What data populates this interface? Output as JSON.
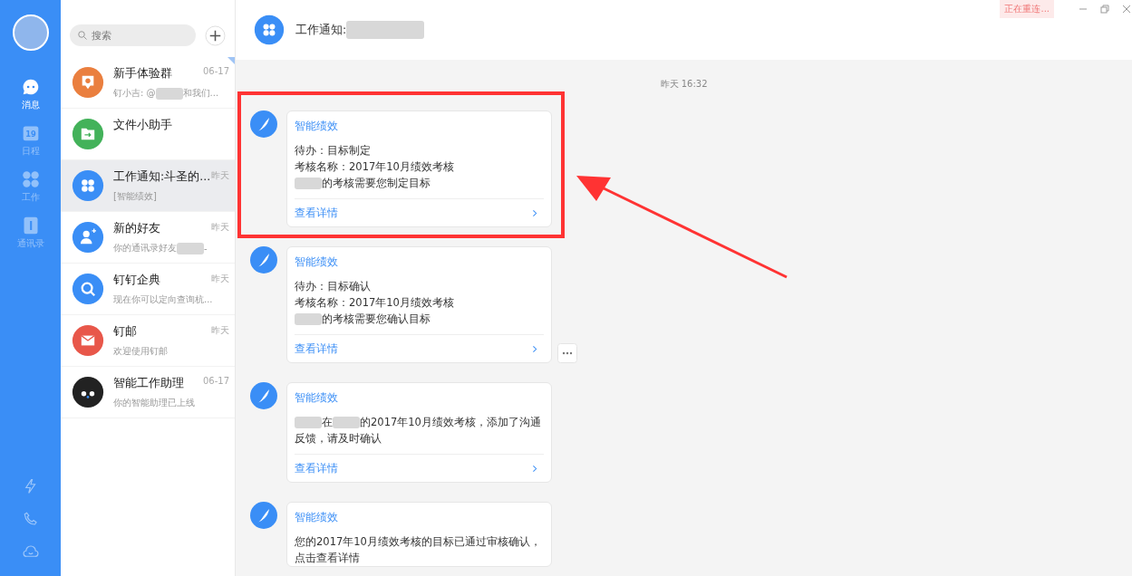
{
  "nav": {
    "items": [
      {
        "label": "消息",
        "kind": "chat",
        "selected": true
      },
      {
        "label": "日程",
        "kind": "calendar",
        "selected": false
      },
      {
        "label": "工作",
        "kind": "work",
        "selected": false
      },
      {
        "label": "通讯录",
        "kind": "contacts",
        "selected": false
      }
    ],
    "calendar_day": "19"
  },
  "search": {
    "placeholder": "搜索"
  },
  "conversations": [
    {
      "name": "新手体验群",
      "time": "06-17",
      "preview": [
        {
          "kind": "text",
          "text": "钉小吉: @"
        },
        {
          "kind": "blur"
        },
        {
          "kind": "text",
          "text": "和我们..."
        }
      ],
      "kind": "group",
      "color": "#ea7f3f",
      "selected": false,
      "unread": true
    },
    {
      "name": "文件小助手",
      "kind": "folder",
      "color": "#43b25a",
      "selected": false,
      "unread": false
    },
    {
      "name": "工作通知:斗圣的...",
      "time": "昨天",
      "preview": [
        {
          "kind": "text",
          "text": "[智能绩效]"
        }
      ],
      "kind": "work",
      "color": "#3a8ef6",
      "selected": true,
      "unread": false
    },
    {
      "name": "新的好友",
      "time": "昨天",
      "preview": [
        {
          "kind": "text",
          "text": "你的通讯录好友"
        },
        {
          "kind": "blur"
        },
        {
          "kind": "text",
          "text": "-"
        }
      ],
      "kind": "add-user",
      "color": "#3a8ef6",
      "selected": false,
      "unread": false
    },
    {
      "name": "钉钉企典",
      "time": "昨天",
      "preview": [
        {
          "kind": "text",
          "text": "现在你可以定向查询杭..."
        }
      ],
      "kind": "search",
      "color": "#3a8ef6",
      "selected": false,
      "unread": false
    },
    {
      "name": "钉邮",
      "time": "昨天",
      "preview": [
        {
          "kind": "text",
          "text": "欢迎使用钉邮"
        }
      ],
      "kind": "mail",
      "color": "#e8574a",
      "selected": false,
      "unread": false
    },
    {
      "name": "智能工作助理",
      "time": "06-17",
      "preview": [
        {
          "kind": "text",
          "text": "你的智能助理已上线"
        }
      ],
      "kind": "robot",
      "color": "#222222",
      "selected": false,
      "unread": false
    }
  ],
  "chat": {
    "title": [
      {
        "kind": "text",
        "text": "工作通知:"
      },
      {
        "kind": "blur"
      }
    ],
    "status": "正在重连...",
    "timestamp": "昨天 16:32",
    "messages": [
      {
        "sender": "智能绩效",
        "lines": [
          [
            {
              "kind": "text",
              "text": "待办：目标制定"
            }
          ],
          [
            {
              "kind": "text",
              "text": "考核名称：2017年10月绩效考核"
            }
          ],
          [
            {
              "kind": "blur"
            },
            {
              "kind": "text",
              "text": "的考核需要您制定目标"
            }
          ]
        ],
        "link": "查看详情",
        "highlighted": true
      },
      {
        "sender": "智能绩效",
        "lines": [
          [
            {
              "kind": "text",
              "text": "待办：目标确认"
            }
          ],
          [
            {
              "kind": "text",
              "text": "考核名称：2017年10月绩效考核"
            }
          ],
          [
            {
              "kind": "blur"
            },
            {
              "kind": "text",
              "text": "的考核需要您确认目标"
            }
          ]
        ],
        "link": "查看详情",
        "more_button": true
      },
      {
        "sender": "智能绩效",
        "lines": [
          [
            {
              "kind": "blur"
            },
            {
              "kind": "text",
              "text": "在"
            },
            {
              "kind": "blur"
            },
            {
              "kind": "text",
              "text": "的2017年10月绩效考核，添加了沟通反馈，请及时确认"
            }
          ]
        ],
        "link": "查看详情"
      },
      {
        "sender": "智能绩效",
        "lines": [
          [
            {
              "kind": "text",
              "text": "您的2017年10月绩效考核的目标已通过审核确认，点击查看详情"
            }
          ]
        ]
      }
    ]
  }
}
